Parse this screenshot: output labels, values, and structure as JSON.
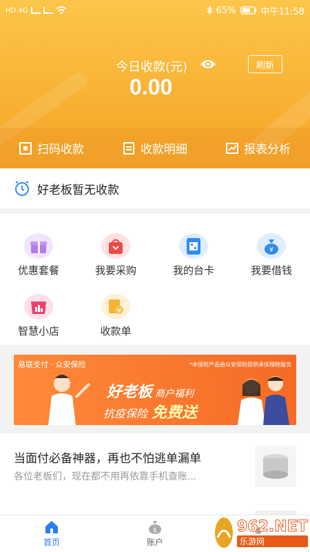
{
  "status_bar": {
    "left_text": "HD 4G",
    "battery": "65%",
    "time": "中午11:58"
  },
  "header": {
    "income_label": "今日收款(元)",
    "amount": "0.00",
    "refresh_label": "刷新",
    "actions": [
      {
        "label": "扫码收款",
        "icon": "scan-icon"
      },
      {
        "label": "收款明细",
        "icon": "receipt-icon"
      },
      {
        "label": "报表分析",
        "icon": "report-icon"
      }
    ]
  },
  "notice": {
    "text": "好老板暂无收款"
  },
  "grid": {
    "items": [
      {
        "label": "优惠套餐",
        "icon": "gift-icon",
        "color": "#c58bf0"
      },
      {
        "label": "我要采购",
        "icon": "shopping-bag-icon",
        "color": "#f04747"
      },
      {
        "label": "我的台卡",
        "icon": "qr-card-icon",
        "color": "#2f8cf0"
      },
      {
        "label": "我要借钱",
        "icon": "money-bag-icon",
        "color": "#2f8cf0"
      },
      {
        "label": "智慧小店",
        "icon": "store-chart-icon",
        "color": "#f0406a"
      },
      {
        "label": "收款单",
        "icon": "bill-icon",
        "color": "#f5b331"
      }
    ]
  },
  "banner": {
    "brand": "易联支付 · 众安保险",
    "note": "*本保险产品由众安保险提供承保理赔服务",
    "title": "好老板",
    "title_suffix": "商户福利",
    "sub": "抗疫保险",
    "sub_suffix": "免费送"
  },
  "article": {
    "title": "当面付必备神器，再也不怕逃单漏单",
    "desc": "各位老板们，现在都不用再依靠手机查账..."
  },
  "tabbar": {
    "tabs": [
      {
        "label": "首页",
        "icon": "home-icon",
        "active": true
      },
      {
        "label": "账户",
        "icon": "account-bag-icon",
        "active": false
      },
      {
        "label": "",
        "icon": "profile-icon",
        "active": false
      }
    ]
  },
  "watermark": {
    "top": "962.NET",
    "bottom": "乐游网"
  },
  "colors": {
    "header_top": "#fcc64a",
    "header_bottom": "#f4a52b",
    "accent": "#2a7cf7",
    "banner": "#f56a25"
  }
}
